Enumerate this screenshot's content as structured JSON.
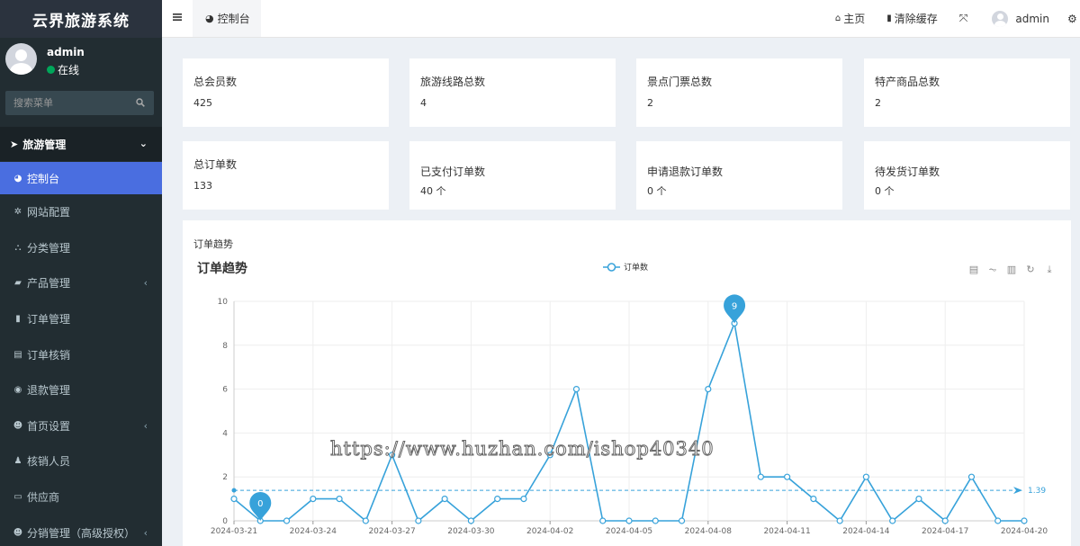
{
  "sidebar": {
    "logo": "云界旅游系统",
    "user": {
      "name": "admin",
      "status": "在线"
    },
    "search_placeholder": "搜索菜单",
    "section": "旅游管理",
    "items": [
      {
        "label": "控制台",
        "icon": "dashboard-icon",
        "active": true
      },
      {
        "label": "网站配置",
        "icon": "gear-icon"
      },
      {
        "label": "分类管理",
        "icon": "sitemap-icon"
      },
      {
        "label": "产品管理",
        "icon": "suitcase-icon",
        "arrow": true
      },
      {
        "label": "订单管理",
        "icon": "file-icon"
      },
      {
        "label": "订单核销",
        "icon": "file-text-icon"
      },
      {
        "label": "退款管理",
        "icon": "eye-icon"
      },
      {
        "label": "首页设置",
        "icon": "users-icon",
        "arrow": true
      },
      {
        "label": "核销人员",
        "icon": "user-icon"
      },
      {
        "label": "供应商",
        "icon": "id-card-icon"
      },
      {
        "label": "分销管理（高级授权）",
        "icon": "users-icon",
        "arrow": true
      }
    ]
  },
  "header": {
    "tab": "控制台",
    "home": "主页",
    "clear_cache": "清除缓存",
    "user": "admin"
  },
  "stats": [
    {
      "label": "总会员数",
      "value": "425"
    },
    {
      "label": "旅游线路总数",
      "value": "4"
    },
    {
      "label": "景点门票总数",
      "value": "2"
    },
    {
      "label": "特产商品总数",
      "value": "2"
    },
    {
      "label": "总订单数",
      "value": "133"
    },
    {
      "label": "已支付订单数",
      "value": "40 个"
    },
    {
      "label": "申请退款订单数",
      "value": "0 个"
    },
    {
      "label": "待发货订单数",
      "value": "0 个"
    }
  ],
  "panel_title": "订单趋势",
  "watermark": "https://www.huzhan.com/ishop40340",
  "colors": {
    "accent": "#4a6ee0",
    "line": "#37a2da",
    "sidebar": "#222d32"
  },
  "chart_data": {
    "type": "line",
    "title": "订单趋势",
    "legend": "订单数",
    "ylim": [
      0,
      10
    ],
    "yticks": [
      0,
      2,
      4,
      6,
      8,
      10
    ],
    "x": [
      "2024-03-21",
      "2024-03-22",
      "2024-03-23",
      "2024-03-24",
      "2024-03-25",
      "2024-03-26",
      "2024-03-27",
      "2024-03-28",
      "2024-03-29",
      "2024-03-30",
      "2024-03-31",
      "2024-04-01",
      "2024-04-02",
      "2024-04-03",
      "2024-04-04",
      "2024-04-05",
      "2024-04-06",
      "2024-04-07",
      "2024-04-08",
      "2024-04-09",
      "2024-04-10",
      "2024-04-11",
      "2024-04-12",
      "2024-04-13",
      "2024-04-14",
      "2024-04-15",
      "2024-04-16",
      "2024-04-17",
      "2024-04-18",
      "2024-04-19",
      "2024-04-20"
    ],
    "xticks": [
      "2024-03-21",
      "2024-03-24",
      "2024-03-27",
      "2024-03-30",
      "2024-04-02",
      "2024-04-05",
      "2024-04-08",
      "2024-04-11",
      "2024-04-14",
      "2024-04-17",
      "2024-04-20"
    ],
    "values": [
      1,
      0,
      0,
      1,
      1,
      0,
      3,
      0,
      1,
      0,
      1,
      1,
      3,
      6,
      0,
      0,
      0,
      0,
      6,
      9,
      2,
      2,
      1,
      0,
      2,
      0,
      1,
      0,
      2,
      0,
      0
    ],
    "mark_point_max": {
      "x": "2024-04-09",
      "value": 9
    },
    "mark_point_min": {
      "x": "2024-03-22",
      "value": 0
    },
    "mark_line_avg": 1.39,
    "grid": true,
    "legend_position": "top-center"
  }
}
